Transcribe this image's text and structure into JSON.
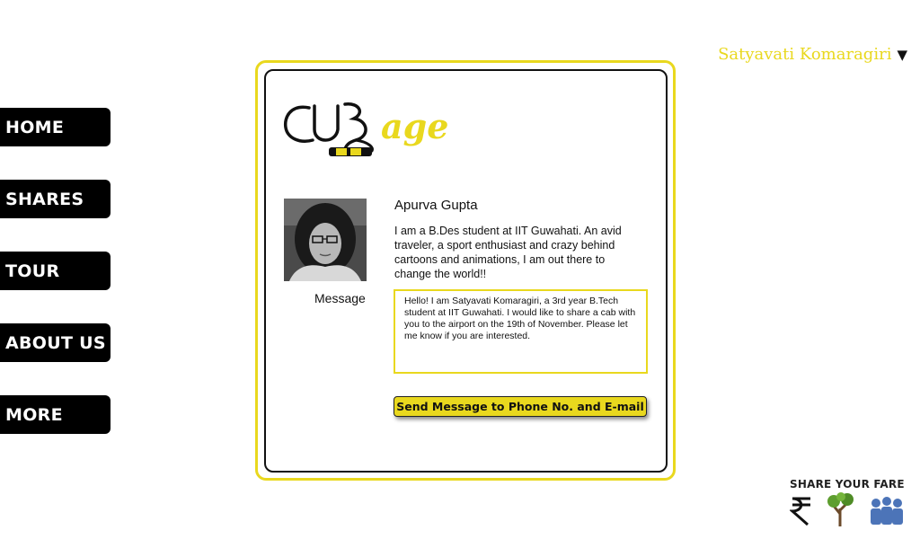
{
  "user": {
    "name": "Satyavati Komaragiri",
    "caret": "▼"
  },
  "nav": {
    "items": [
      {
        "label": "HOME"
      },
      {
        "label": "SHARES"
      },
      {
        "label": "TOUR"
      },
      {
        "label": "ABOUT US"
      },
      {
        "label": "MORE"
      }
    ]
  },
  "logo": {
    "text": "Cabsage",
    "accent_color": "#e9d81e"
  },
  "profile": {
    "name": "Apurva Gupta",
    "bio": "I am a B.Des student at IIT Guwahati. An avid traveler, a sport enthusiast and crazy behind cartoons and animations, I am out there to change the world!!"
  },
  "message": {
    "label": "Message",
    "text": "Hello! I am Satyavati Komaragiri, a 3rd year B.Tech student at IIT Guwahati. I would like to share a cab with you to the airport on the 19th of November. Please let me know if you are interested."
  },
  "send_button": {
    "label": "Send Message to Phone No. and E-mail"
  },
  "footer": {
    "title": "SHARE YOUR FARE",
    "icons": [
      "rupee-icon",
      "tree-icon",
      "people-icon"
    ]
  },
  "colors": {
    "accent": "#e9d81e",
    "nav_bg": "#000000"
  }
}
